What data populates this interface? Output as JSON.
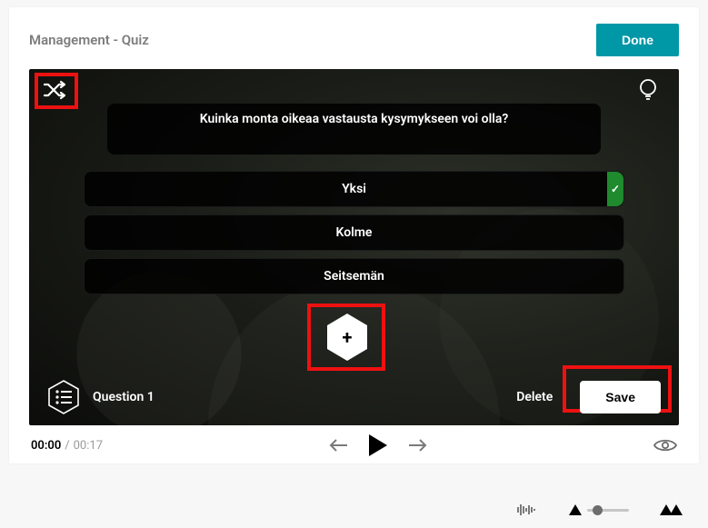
{
  "header": {
    "title": "Management - Quiz",
    "done_label": "Done"
  },
  "quiz": {
    "prompt": "Kuinka monta oikeaa vastausta kysymykseen voi olla?",
    "answers": [
      {
        "label": "Yksi",
        "correct": true
      },
      {
        "label": "Kolme",
        "correct": false
      },
      {
        "label": "Seitsemän",
        "correct": false
      }
    ],
    "checkmark": "✓",
    "add_glyph": "+"
  },
  "footer": {
    "question_label": "Question 1",
    "delete_label": "Delete",
    "save_label": "Save"
  },
  "timeline": {
    "current": "00:00",
    "separator": "/",
    "duration": "00:17"
  }
}
